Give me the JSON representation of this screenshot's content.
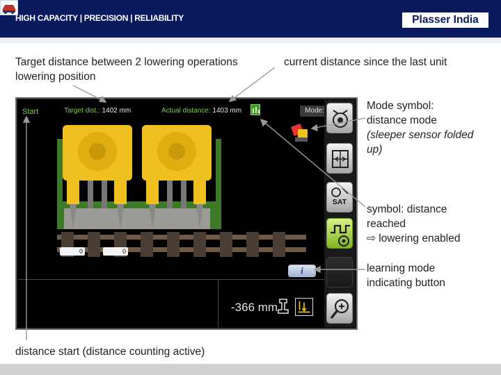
{
  "header": {
    "tagline": "HIGH CAPACITY | PRECISION | RELIABILITY",
    "brand": "Plasser India"
  },
  "annotations": {
    "target_distance": "Target distance between 2 lowering operations",
    "lowering_position": "lowering position",
    "current_distance": "current distance since the last unit",
    "mode_symbol_1": "Mode symbol:",
    "mode_symbol_2": "distance mode",
    "mode_symbol_3": "(sleeper sensor folded",
    "mode_symbol_4": "up)",
    "distance_reached_1": "symbol: distance",
    "distance_reached_2": "reached",
    "distance_reached_3": "⇨ lowering enabled",
    "learning_mode_1": "learning mode",
    "learning_mode_2": "indicating button",
    "distance_start": "distance start (distance counting active)"
  },
  "screen": {
    "start": "Start",
    "target_dist_label": "Target dist.:",
    "target_dist_value": "1402 mm",
    "actual_distance_label": "Actual distance:",
    "actual_distance_value": "1403 mm",
    "mode_label": "Mode:",
    "counter_left": "0",
    "counter_right": "0",
    "info_button": "i",
    "offset": "-366 mm",
    "sat_label": "SAT"
  },
  "colors": {
    "header_bg": "#0a1a5e",
    "screen_label": "#7bd23f",
    "machine_yellow": "#f0c020",
    "button_green": "#a5d33b"
  },
  "icons": {
    "mode": "tamping-unit-icon",
    "distance_reached": "pulse-target-icon",
    "learning": "learning-mode-button",
    "zoom": "zoom-in-icon"
  }
}
